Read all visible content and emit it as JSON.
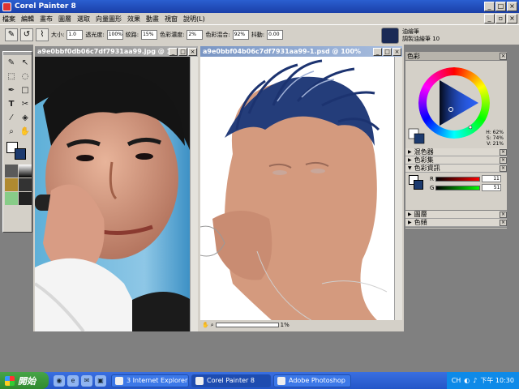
{
  "app": {
    "title": "Corel Painter 8"
  },
  "menu": [
    "檔案",
    "編輯",
    "畫布",
    "圖層",
    "選取",
    "向量圖形",
    "效果",
    "動畫",
    "視窗",
    "說明(L)"
  ],
  "property_bar": {
    "size_label": "大小:",
    "size_value": "1.0",
    "opacity_label": "透光度:",
    "opacity_value": "100%",
    "grain_label": "紋路:",
    "grain_value": "15%",
    "resat_label": "色彩濃度:",
    "resat_value": "2%",
    "bleed_label": "色彩混合:",
    "bleed_value": "92%",
    "jitter_label": "抖動:",
    "jitter_value": "0.00"
  },
  "brush": {
    "category": "油繪筆",
    "variant": "調製油繪筆 10"
  },
  "doc1": {
    "title": "a9e0bbf0db06c7df7931aa99.jpg @ 10..."
  },
  "doc2": {
    "title": "a9e0bbf04b06c7df7931aa99-1.psd @ 100%"
  },
  "doc2_status": {
    "zoom_readout": "1%"
  },
  "palettes": {
    "color_title": "色彩",
    "hsv": {
      "h": "H: 62%",
      "s": "S: 74%",
      "v": "V: 21%"
    },
    "rows": [
      "混色器",
      "色彩集",
      "色彩資訊"
    ],
    "rgb": {
      "r_label": "R",
      "r_value": "11",
      "g_label": "G",
      "g_value": "51"
    },
    "layers": "圖層",
    "channels": "色頻"
  },
  "taskbar": {
    "start": "開始",
    "tasks": [
      "3 Internet Explorer",
      "Corel Painter 8",
      "Adobe Photoshop"
    ],
    "lang": "CH",
    "clock": "下午 10:30"
  },
  "colors": {
    "accent": "#2b5fd0",
    "primary_color": "#ffffff",
    "secondary_color": "#1c3a6e"
  }
}
